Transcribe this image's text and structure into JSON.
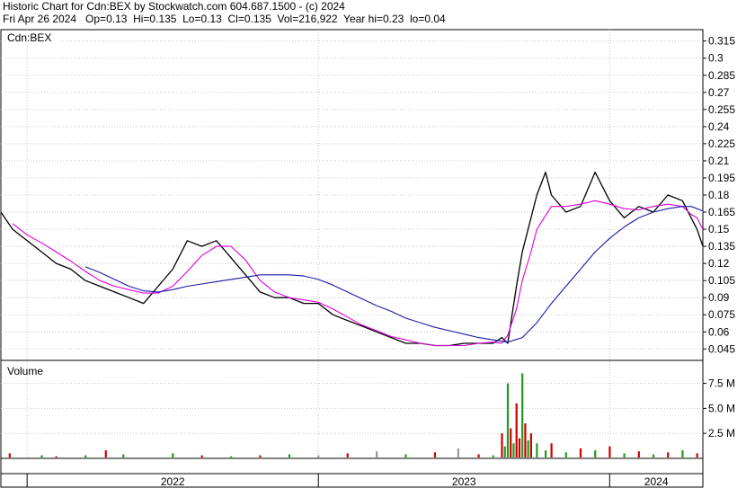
{
  "header": {
    "line1": "Historic Chart for Cdn:BEX by Stockwatch.com 604.687.1500 - (c) 2024",
    "line2": "Fri Apr 26 2024   Op=0.13  Hi=0.135  Lo=0.13  Cl=0.135  Vol=216,922  Year hi=0.23  lo=0.04"
  },
  "chart_data": {
    "type": "line",
    "symbol_label": "Cdn:BEX",
    "volume_label": "Volume",
    "price_axis": {
      "ylim": [
        0.035,
        0.325
      ],
      "ticks": [
        0.045,
        0.06,
        0.075,
        0.09,
        0.105,
        0.12,
        0.135,
        0.15,
        0.165,
        0.18,
        0.195,
        0.21,
        0.225,
        0.24,
        0.255,
        0.27,
        0.285,
        0.3,
        0.315
      ],
      "tick_labels": [
        "0.045",
        "0.06",
        "0.075",
        "0.09",
        "0.105",
        "0.12",
        "0.135",
        "0.15",
        "0.165",
        "0.18",
        "0.195",
        "0.21",
        "0.225",
        "0.24",
        "0.255",
        "0.27",
        "0.285",
        "0.3",
        "0.315"
      ]
    },
    "volume_axis": {
      "ylim": [
        0,
        9.8
      ],
      "ticks": [
        2.5,
        5.0,
        7.5
      ],
      "tick_labels": [
        "2.5 M",
        "5.0 M",
        "7.5 M"
      ]
    },
    "x_axis": {
      "range": [
        2021.91,
        2024.32
      ],
      "years": [
        {
          "label": "2022",
          "start": 2022.0
        },
        {
          "label": "2023",
          "start": 2023.0
        },
        {
          "label": "2024",
          "start": 2024.0
        }
      ]
    },
    "grid": true,
    "series": [
      {
        "name": "price",
        "color": "#000000",
        "x": [
          2021.91,
          2021.95,
          2022.0,
          2022.05,
          2022.1,
          2022.15,
          2022.2,
          2022.25,
          2022.3,
          2022.35,
          2022.4,
          2022.45,
          2022.5,
          2022.55,
          2022.6,
          2022.65,
          2022.7,
          2022.75,
          2022.8,
          2022.85,
          2022.9,
          2022.95,
          2023.0,
          2023.05,
          2023.1,
          2023.15,
          2023.2,
          2023.25,
          2023.3,
          2023.35,
          2023.4,
          2023.45,
          2023.5,
          2023.55,
          2023.6,
          2023.63,
          2023.65,
          2023.68,
          2023.7,
          2023.73,
          2023.75,
          2023.78,
          2023.8,
          2023.85,
          2023.9,
          2023.95,
          2024.0,
          2024.05,
          2024.1,
          2024.15,
          2024.2,
          2024.25,
          2024.28,
          2024.3,
          2024.32
        ],
        "y": [
          0.165,
          0.15,
          0.14,
          0.13,
          0.12,
          0.115,
          0.105,
          0.1,
          0.095,
          0.09,
          0.085,
          0.1,
          0.115,
          0.14,
          0.135,
          0.14,
          0.125,
          0.11,
          0.095,
          0.09,
          0.09,
          0.085,
          0.085,
          0.075,
          0.07,
          0.065,
          0.06,
          0.055,
          0.05,
          0.05,
          0.048,
          0.048,
          0.05,
          0.05,
          0.05,
          0.055,
          0.05,
          0.1,
          0.13,
          0.16,
          0.18,
          0.2,
          0.18,
          0.165,
          0.17,
          0.2,
          0.175,
          0.16,
          0.17,
          0.165,
          0.18,
          0.175,
          0.16,
          0.15,
          0.135
        ]
      },
      {
        "name": "short moving average",
        "color": "#dd00dd",
        "x": [
          2021.95,
          2022.0,
          2022.05,
          2022.1,
          2022.15,
          2022.2,
          2022.25,
          2022.3,
          2022.35,
          2022.4,
          2022.45,
          2022.5,
          2022.55,
          2022.6,
          2022.65,
          2022.7,
          2022.75,
          2022.8,
          2022.85,
          2022.9,
          2022.95,
          2023.0,
          2023.05,
          2023.1,
          2023.15,
          2023.2,
          2023.25,
          2023.3,
          2023.35,
          2023.4,
          2023.45,
          2023.5,
          2023.55,
          2023.6,
          2023.63,
          2023.65,
          2023.68,
          2023.7,
          2023.73,
          2023.75,
          2023.78,
          2023.8,
          2023.85,
          2023.9,
          2023.95,
          2024.0,
          2024.05,
          2024.1,
          2024.15,
          2024.2,
          2024.25,
          2024.28,
          2024.3,
          2024.32
        ],
        "y": [
          0.155,
          0.145,
          0.138,
          0.13,
          0.122,
          0.113,
          0.105,
          0.1,
          0.097,
          0.094,
          0.094,
          0.1,
          0.113,
          0.127,
          0.135,
          0.135,
          0.123,
          0.105,
          0.095,
          0.09,
          0.088,
          0.086,
          0.08,
          0.073,
          0.066,
          0.061,
          0.056,
          0.053,
          0.05,
          0.048,
          0.048,
          0.048,
          0.05,
          0.051,
          0.05,
          0.057,
          0.08,
          0.105,
          0.13,
          0.15,
          0.162,
          0.17,
          0.17,
          0.172,
          0.175,
          0.172,
          0.168,
          0.167,
          0.17,
          0.172,
          0.17,
          0.163,
          0.16,
          0.15
        ]
      },
      {
        "name": "long moving average",
        "color": "#1a1aa8",
        "x": [
          2022.2,
          2022.25,
          2022.3,
          2022.35,
          2022.4,
          2022.45,
          2022.5,
          2022.55,
          2022.6,
          2022.65,
          2022.7,
          2022.75,
          2022.8,
          2022.85,
          2022.9,
          2022.95,
          2023.0,
          2023.05,
          2023.1,
          2023.15,
          2023.2,
          2023.25,
          2023.3,
          2023.35,
          2023.4,
          2023.45,
          2023.5,
          2023.55,
          2023.6,
          2023.65,
          2023.7,
          2023.75,
          2023.8,
          2023.85,
          2023.9,
          2023.95,
          2024.0,
          2024.05,
          2024.1,
          2024.15,
          2024.2,
          2024.25,
          2024.28,
          2024.3,
          2024.32
        ],
        "y": [
          0.117,
          0.112,
          0.106,
          0.1,
          0.096,
          0.095,
          0.097,
          0.1,
          0.102,
          0.104,
          0.106,
          0.108,
          0.11,
          0.11,
          0.11,
          0.109,
          0.106,
          0.101,
          0.095,
          0.089,
          0.083,
          0.078,
          0.072,
          0.068,
          0.064,
          0.061,
          0.058,
          0.055,
          0.053,
          0.051,
          0.055,
          0.068,
          0.085,
          0.1,
          0.115,
          0.13,
          0.142,
          0.152,
          0.16,
          0.165,
          0.168,
          0.17,
          0.17,
          0.168,
          0.166
        ]
      }
    ],
    "volume": {
      "x": [
        2021.94,
        2022.05,
        2022.1,
        2022.2,
        2022.27,
        2022.33,
        2022.5,
        2022.6,
        2022.7,
        2022.8,
        2022.9,
        2023.0,
        2023.1,
        2023.2,
        2023.3,
        2023.4,
        2023.48,
        2023.55,
        2023.6,
        2023.63,
        2023.64,
        2023.65,
        2023.66,
        2023.67,
        2023.68,
        2023.69,
        2023.7,
        2023.71,
        2023.72,
        2023.73,
        2023.75,
        2023.78,
        2023.8,
        2023.85,
        2023.9,
        2023.95,
        2024.0,
        2024.05,
        2024.1,
        2024.15,
        2024.2,
        2024.25,
        2024.3
      ],
      "values": [
        0.5,
        0.3,
        0.2,
        0.3,
        0.8,
        0.4,
        0.5,
        0.3,
        0.2,
        0.3,
        0.4,
        0.3,
        0.5,
        0.7,
        0.4,
        0.6,
        1.0,
        0.4,
        0.3,
        2.5,
        1.2,
        7.5,
        3.0,
        1.5,
        5.5,
        2.0,
        8.5,
        3.5,
        1.8,
        2.5,
        1.5,
        0.8,
        1.5,
        0.6,
        1.0,
        0.8,
        1.2,
        0.5,
        0.7,
        0.4,
        0.6,
        0.8,
        0.5
      ],
      "colors": [
        "#cc0000",
        "#229922",
        "#cc0000",
        "#229922",
        "#cc0000",
        "#229922",
        "#229922",
        "#cc0000",
        "#229922",
        "#cc0000",
        "#229922",
        "#999999",
        "#cc0000",
        "#999999",
        "#229922",
        "#cc0000",
        "#999999",
        "#cc0000",
        "#229922",
        "#cc0000",
        "#229922",
        "#229922",
        "#cc0000",
        "#229922",
        "#cc0000",
        "#cc0000",
        "#229922",
        "#cc0000",
        "#229922",
        "#cc0000",
        "#229922",
        "#229922",
        "#cc0000",
        "#229922",
        "#cc0000",
        "#229922",
        "#cc0000",
        "#229922",
        "#cc0000",
        "#229922",
        "#cc0000",
        "#229922",
        "#cc0000"
      ]
    }
  }
}
